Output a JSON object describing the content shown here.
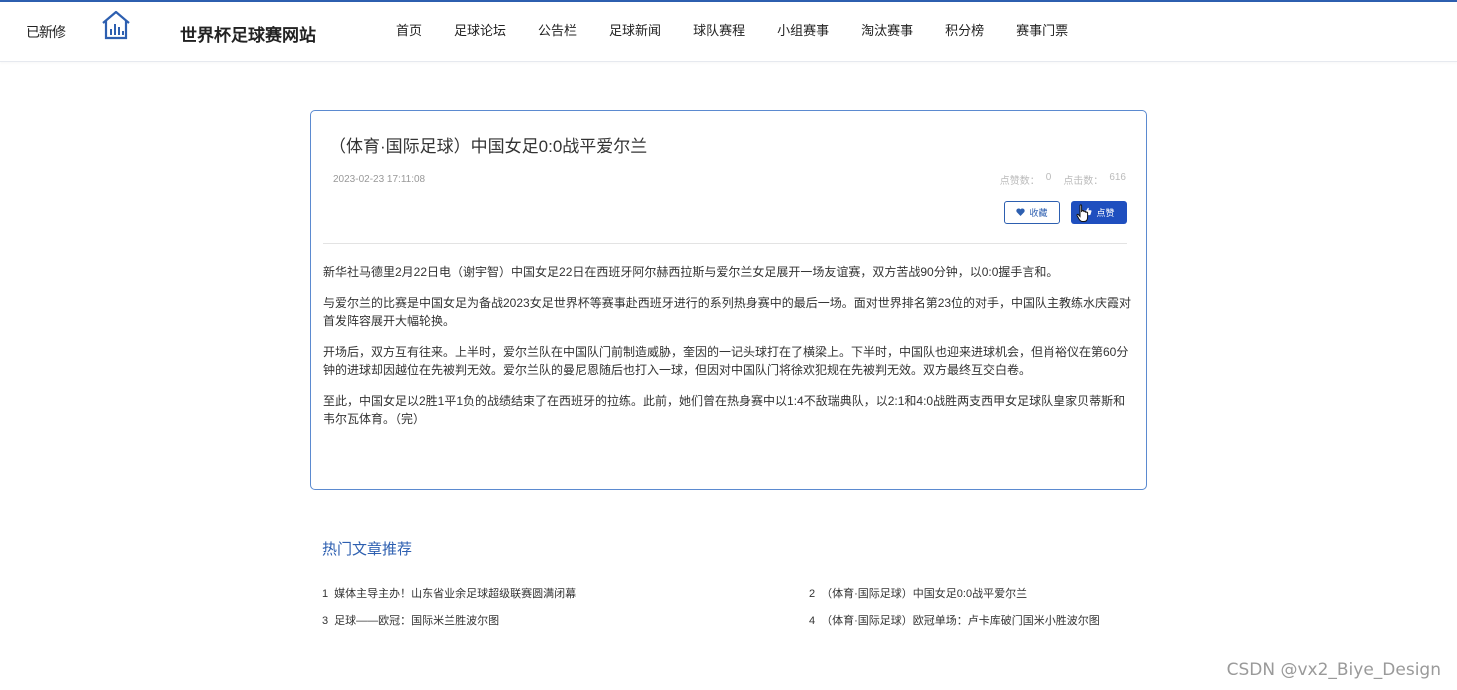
{
  "header": {
    "scribble_text": "已新修",
    "site_title": "世界杯足球赛网站",
    "logo_icon": "house-chart-icon",
    "nav": [
      {
        "label": "首页"
      },
      {
        "label": "足球论坛"
      },
      {
        "label": "公告栏"
      },
      {
        "label": "足球新闻"
      },
      {
        "label": "球队赛程"
      },
      {
        "label": "小组赛事"
      },
      {
        "label": "淘汰赛事"
      },
      {
        "label": "积分榜"
      },
      {
        "label": "赛事门票"
      }
    ]
  },
  "article": {
    "title": "（体育·国际足球）中国女足0:0战平爱尔兰",
    "date": "2023-02-23 17:11:08",
    "likes_label": "点赞数：",
    "likes": "0",
    "clicks_label": "点击数：",
    "clicks": "616",
    "collect_label": "收藏",
    "like_label": "点赞",
    "paragraphs": [
      "新华社马德里2月22日电（谢宇智）中国女足22日在西班牙阿尔赫西拉斯与爱尔兰女足展开一场友谊赛，双方苦战90分钟，以0:0握手言和。",
      "与爱尔兰的比赛是中国女足为备战2023女足世界杯等赛事赴西班牙进行的系列热身赛中的最后一场。面对世界排名第23位的对手，中国队主教练水庆霞对首发阵容展开大幅轮换。",
      "开场后，双方互有往来。上半时，爱尔兰队在中国队门前制造威胁，奎因的一记头球打在了横梁上。下半时，中国队也迎来进球机会，但肖裕仪在第60分钟的进球却因越位在先被判无效。爱尔兰队的曼尼恩随后也打入一球，但因对中国队门将徐欢犯规在先被判无效。双方最终互交白卷。",
      "至此，中国女足以2胜1平1负的战绩结束了在西班牙的拉练。此前，她们曾在热身赛中以1:4不敌瑞典队，以2:1和4:0战胜两支西甲女足球队皇家贝蒂斯和韦尔瓦体育。（完）"
    ]
  },
  "hot": {
    "title": "热门文章推荐",
    "items": [
      {
        "num": "1",
        "title": "媒体主导主办！山东省业余足球超级联赛圆满闭幕"
      },
      {
        "num": "2",
        "title": "（体育·国际足球）中国女足0:0战平爱尔兰"
      },
      {
        "num": "3",
        "title": "足球——欧冠：国际米兰胜波尔图"
      },
      {
        "num": "4",
        "title": "（体育·国际足球）欧冠单场：卢卡库破门国米小胜波尔图"
      }
    ]
  },
  "watermark": "CSDN @vx2_Biye_Design",
  "colors": {
    "accent": "#2d5fb0",
    "button": "#1f4fbf"
  }
}
